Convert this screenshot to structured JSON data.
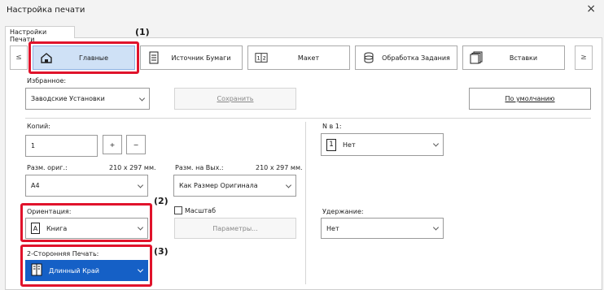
{
  "window": {
    "title": "Настройка печати",
    "close_glyph": "×"
  },
  "tab": {
    "label": "Настройки Печати"
  },
  "nav": {
    "prev_glyph": "≤",
    "next_glyph": "≥"
  },
  "features": [
    {
      "label": "Главные",
      "icon": "home-icon",
      "active": true
    },
    {
      "label": "Источник Бумаги",
      "icon": "paper-tray-icon",
      "active": false
    },
    {
      "label": "Макет",
      "icon": "layout-icon",
      "active": false
    },
    {
      "label": "Обработка Задания",
      "icon": "job-handling-icon",
      "active": false
    },
    {
      "label": "Вставки",
      "icon": "inserts-icon",
      "active": false
    }
  ],
  "favorites": {
    "label": "Избранное:",
    "value": "Заводские Установки",
    "save_label": "Сохранить",
    "default_label": "По умолчанию"
  },
  "copies": {
    "label": "Копий:",
    "value": "1",
    "plus": "+",
    "minus": "−"
  },
  "nup": {
    "label": "N в 1:",
    "value": "Нет",
    "icon_glyph": "1"
  },
  "orig_size": {
    "label": "Разм. ориг.:",
    "dims": "210 x 297 мм.",
    "value": "A4"
  },
  "output_size": {
    "label": "Разм. на Вых.:",
    "dims": "210 x 297 мм.",
    "value": "Как Размер Оригинала"
  },
  "orientation": {
    "label": "Ориентация:",
    "value": "Книга",
    "icon_glyph": "A"
  },
  "scale": {
    "label": "Масштаб",
    "params_label": "Параметры..."
  },
  "retention": {
    "label": "Удержание:",
    "value": "Нет"
  },
  "duplex": {
    "label": "2-Сторонняя Печать:",
    "value": "Длинный Край"
  },
  "callouts": [
    "(1)",
    "(2)",
    "(3)"
  ],
  "colors": {
    "highlight": "#e0132b",
    "selection": "#1560c6",
    "active_tab": "#cfe1f6"
  }
}
